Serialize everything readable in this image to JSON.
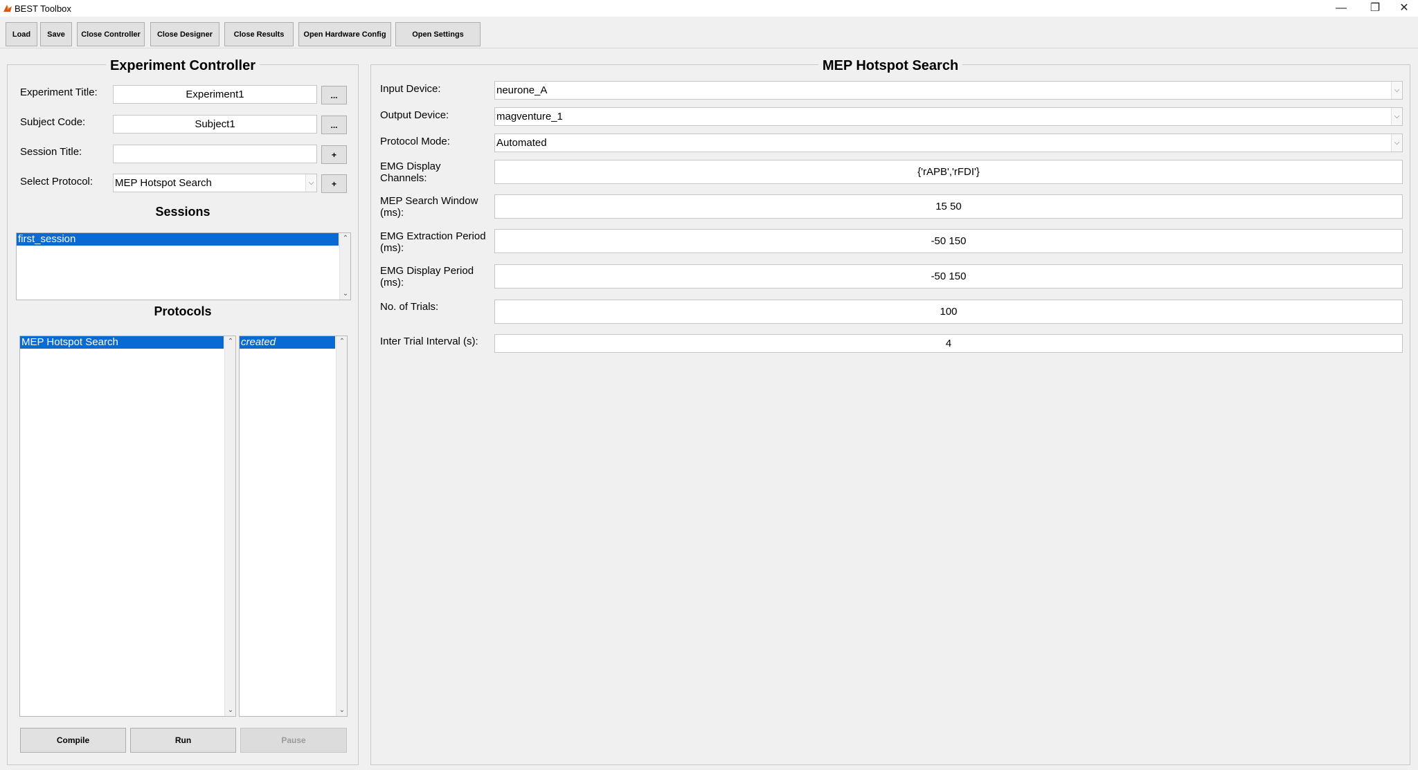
{
  "window": {
    "title": "BEST Toolbox",
    "minimize_glyph": "—",
    "restore_glyph": "❐",
    "close_glyph": "✕"
  },
  "toolbar": {
    "load": "Load",
    "save": "Save",
    "close_controller": "Close Controller",
    "close_designer": "Close Designer",
    "close_results": "Close Results",
    "open_hardware_config": "Open Hardware Config",
    "open_settings": "Open Settings"
  },
  "controller": {
    "title": "Experiment Controller",
    "experiment_title_label": "Experiment Title:",
    "experiment_title_value": "Experiment1",
    "subject_code_label": "Subject Code:",
    "subject_code_value": "Subject1",
    "session_title_label": "Session Title:",
    "session_title_value": "",
    "select_protocol_label": "Select Protocol:",
    "select_protocol_value": "MEP Hotspot Search",
    "browse_btn": "...",
    "add_btn": "+",
    "sessions_title": "Sessions",
    "sessions": [
      "first_session"
    ],
    "protocols_title": "Protocols",
    "protocols": [
      "MEP Hotspot Search"
    ],
    "protocol_status": [
      "created"
    ],
    "compile": "Compile",
    "run": "Run",
    "pause": "Pause"
  },
  "designer": {
    "title": "MEP Hotspot Search",
    "input_device_label": "Input Device:",
    "input_device_value": "neurone_A",
    "output_device_label": "Output Device:",
    "output_device_value": "magventure_1",
    "protocol_mode_label": "Protocol Mode:",
    "protocol_mode_value": "Automated",
    "emg_channels_label_1": "EMG Display",
    "emg_channels_label_2": "Channels:",
    "emg_channels_value": "{'rAPB','rFDI'}",
    "mep_window_label_1": "MEP Search Window",
    "mep_window_label_2": "(ms):",
    "mep_window_value": "15 50",
    "emg_extraction_label_1": "EMG Extraction Period",
    "emg_extraction_label_2": "(ms):",
    "emg_extraction_value": "-50 150",
    "emg_display_period_label_1": "EMG Display Period",
    "emg_display_period_label_2": "(ms):",
    "emg_display_period_value": "-50 150",
    "trials_label": "No. of Trials:",
    "trials_value": "100",
    "iti_label": "Inter Trial Interval (s):",
    "iti_value": "4"
  }
}
